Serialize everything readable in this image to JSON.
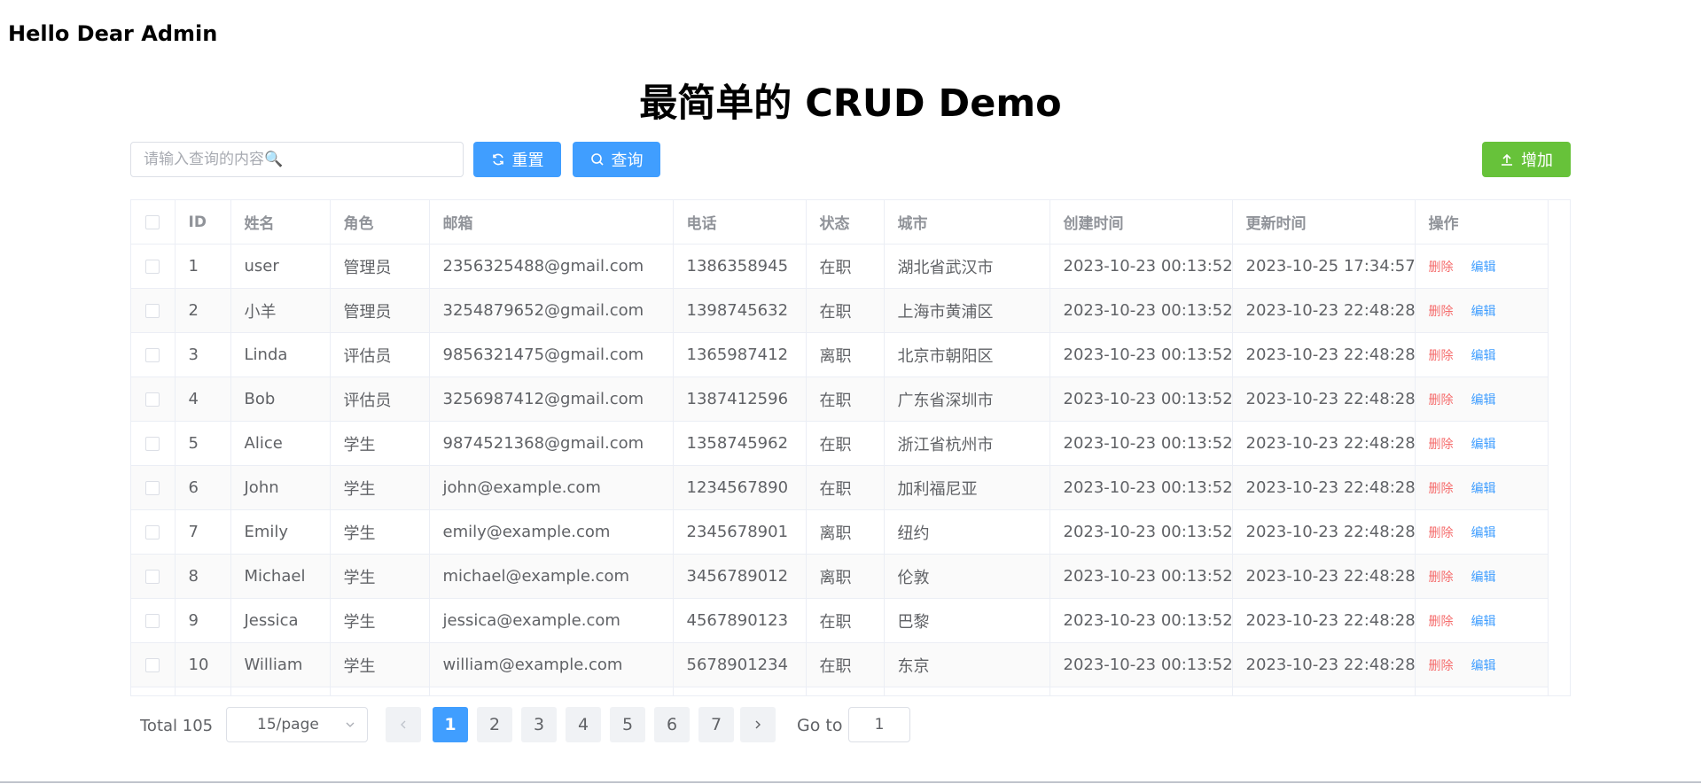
{
  "header": {
    "greeting": "Hello Dear Admin",
    "title": "最简单的 CRUD Demo"
  },
  "toolbar": {
    "search_placeholder": "请输入查询的内容🔍",
    "search_value": "",
    "reset_label": "重置",
    "query_label": "查询",
    "add_label": "增加"
  },
  "table": {
    "columns": [
      "ID",
      "姓名",
      "角色",
      "邮箱",
      "电话",
      "状态",
      "城市",
      "创建时间",
      "更新时间",
      "操作"
    ],
    "delete_label": "删除",
    "edit_label": "编辑",
    "rows": [
      [
        "1",
        "user",
        "管理员",
        "2356325488@gmail.com",
        "1386358945",
        "在职",
        "湖北省武汉市",
        "2023-10-23 00:13:52",
        "2023-10-25 17:34:57"
      ],
      [
        "2",
        "小羊",
        "管理员",
        "3254879652@gmail.com",
        "1398745632",
        "在职",
        "上海市黄浦区",
        "2023-10-23 00:13:52",
        "2023-10-23 22:48:28"
      ],
      [
        "3",
        "Linda",
        "评估员",
        "9856321475@gmail.com",
        "1365987412",
        "离职",
        "北京市朝阳区",
        "2023-10-23 00:13:52",
        "2023-10-23 22:48:28"
      ],
      [
        "4",
        "Bob",
        "评估员",
        "3256987412@gmail.com",
        "1387412596",
        "在职",
        "广东省深圳市",
        "2023-10-23 00:13:52",
        "2023-10-23 22:48:28"
      ],
      [
        "5",
        "Alice",
        "学生",
        "9874521368@gmail.com",
        "1358745962",
        "在职",
        "浙江省杭州市",
        "2023-10-23 00:13:52",
        "2023-10-23 22:48:28"
      ],
      [
        "6",
        "John",
        "学生",
        "john@example.com",
        "1234567890",
        "在职",
        "加利福尼亚",
        "2023-10-23 00:13:52",
        "2023-10-23 22:48:28"
      ],
      [
        "7",
        "Emily",
        "学生",
        "emily@example.com",
        "2345678901",
        "离职",
        "纽约",
        "2023-10-23 00:13:52",
        "2023-10-23 22:48:28"
      ],
      [
        "8",
        "Michael",
        "学生",
        "michael@example.com",
        "3456789012",
        "离职",
        "伦敦",
        "2023-10-23 00:13:52",
        "2023-10-23 22:48:28"
      ],
      [
        "9",
        "Jessica",
        "学生",
        "jessica@example.com",
        "4567890123",
        "在职",
        "巴黎",
        "2023-10-23 00:13:52",
        "2023-10-23 22:48:28"
      ],
      [
        "10",
        "William",
        "学生",
        "william@example.com",
        "5678901234",
        "在职",
        "东京",
        "2023-10-23 00:13:52",
        "2023-10-23 22:48:28"
      ]
    ]
  },
  "pagination": {
    "total": "Total 105",
    "page_size": "15/page",
    "pages": [
      "1",
      "2",
      "3",
      "4",
      "5",
      "6",
      "7"
    ],
    "current": "1",
    "goto_label": "Go to",
    "goto_value": "1"
  },
  "colors": {
    "primary": "#409eff",
    "success": "#67c23a",
    "danger": "#f56c6c"
  }
}
